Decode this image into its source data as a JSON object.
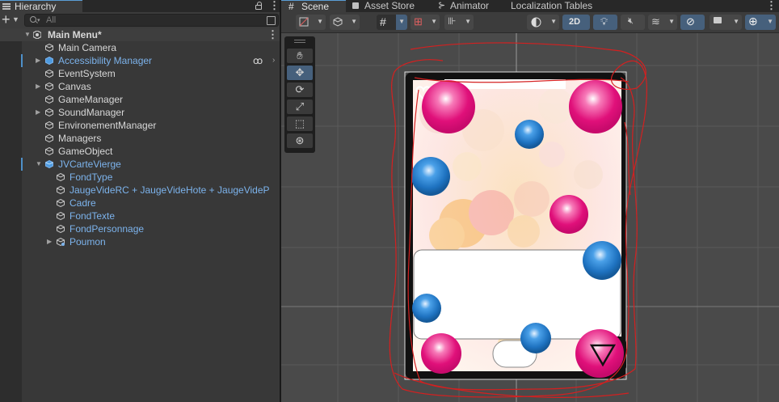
{
  "hierarchy": {
    "tab_label": "Hierarchy",
    "search_placeholder": "All",
    "scene_name": "Main Menu*",
    "items": [
      {
        "label": "Main Camera"
      },
      {
        "label": "Accessibility Manager"
      },
      {
        "label": "EventSystem"
      },
      {
        "label": "Canvas"
      },
      {
        "label": "GameManager"
      },
      {
        "label": "SoundManager"
      },
      {
        "label": "EnvironementManager"
      },
      {
        "label": "Managers"
      },
      {
        "label": "GameObject"
      },
      {
        "label": "JVCarteVierge"
      },
      {
        "label": "FondType"
      },
      {
        "label": "JaugeVideRC + JaugeVideHote + JaugeVideP"
      },
      {
        "label": "Cadre"
      },
      {
        "label": "FondTexte"
      },
      {
        "label": "FondPersonnage"
      },
      {
        "label": "Poumon"
      }
    ],
    "accessibility_badge": "ꝏ"
  },
  "scene": {
    "tabs": [
      {
        "label": "Scene"
      },
      {
        "label": "Asset Store"
      },
      {
        "label": "Animator"
      },
      {
        "label": "Localization Tables"
      }
    ],
    "toolbar": {
      "mode_2d": "2D"
    }
  },
  "colors": {
    "panel": "#383838",
    "selection_blue": "#7cb3ec",
    "viewport": "#4a4a4a",
    "annotation_red": "#d42020",
    "pink_ball": "#e0107a",
    "blue_ball": "#1e72c0"
  }
}
